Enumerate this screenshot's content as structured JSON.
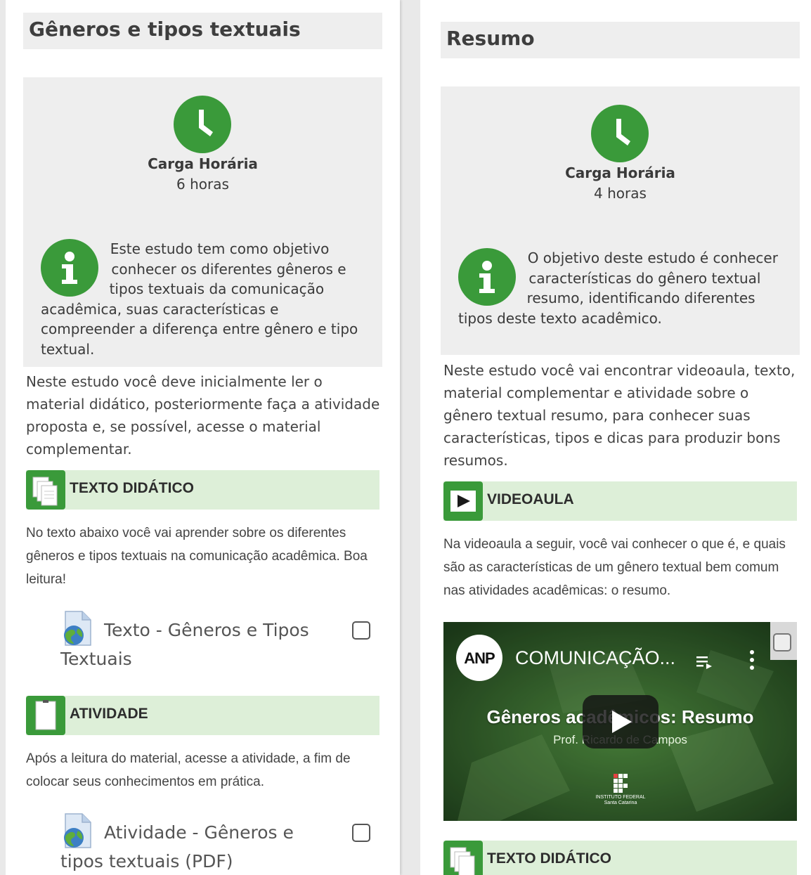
{
  "left": {
    "title": "Gêneros e tipos textuais",
    "carga_label": "Carga Horária",
    "carga_value": "6 horas",
    "objective": "Este estudo tem como objetivo conhecer os diferentes gêneros e tipos textuais da comunicação acadêmica, suas características e compreender a diferença entre gênero e tipo textual.",
    "intro": "Neste estudo você deve inicialmente ler o material didático, posteriormente faça a atividade proposta e, se possível, acesse o material complementar.",
    "sections": [
      {
        "label": "TEXTO DIDÁTICO",
        "description": "No texto abaixo você vai aprender sobre os diferentes gêneros e tipos textuais na comunicação acadêmica. Boa leitura!",
        "resource": "Texto - Gêneros e Tipos Textuais"
      },
      {
        "label": "ATIVIDADE",
        "description": "Após a leitura do material, acesse a atividade, a fim de colocar seus conhecimentos em prática.",
        "resource": "Atividade - Gêneros e tipos textuais (PDF)"
      }
    ]
  },
  "right": {
    "title": "Resumo",
    "carga_label": "Carga Horária",
    "carga_value": "4 horas",
    "objective": "O objetivo deste estudo é conhecer características do gênero textual resumo, identificando diferentes tipos deste texto acadêmico.",
    "intro": "Neste estudo você vai encontrar videoaula, texto, material complementar e atividade sobre o gênero textual resumo, para conhecer suas características, tipos e dicas para produzir bons resumos.",
    "video_section": {
      "label": "VIDEOAULA",
      "description": "Na videoaula a seguir, você vai conhecer o que é, e quais são as características de um gênero textual bem comum nas atividades acadêmicas: o resumo."
    },
    "video": {
      "channel_logo": "ANP",
      "title": "COMUNICAÇÃO...",
      "overlay_title": "Gêneros acadêmicos: Resumo",
      "overlay_subtitle": "Prof. Ricardo de Campos",
      "institute": "INSTITUTO FEDERAL Santa Catarina"
    },
    "next_section": {
      "label": "TEXTO DIDÁTICO"
    }
  },
  "colors": {
    "accent": "#3a9a3a",
    "section_bg": "#ddefd8",
    "box_bg": "#eeeeee"
  },
  "icons": [
    "clock-icon",
    "info-icon",
    "documents-icon",
    "page-icon",
    "video-play-icon",
    "globe-file-icon",
    "checkbox"
  ]
}
